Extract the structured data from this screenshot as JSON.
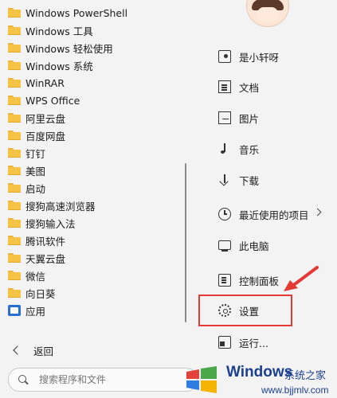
{
  "apps": [
    {
      "label": "Windows PowerShell",
      "icon": "folder-icon"
    },
    {
      "label": "Windows 工具",
      "icon": "folder-icon"
    },
    {
      "label": "Windows 轻松使用",
      "icon": "folder-icon"
    },
    {
      "label": "Windows 系统",
      "icon": "folder-icon"
    },
    {
      "label": "WinRAR",
      "icon": "folder-icon"
    },
    {
      "label": "WPS Office",
      "icon": "folder-icon"
    },
    {
      "label": "阿里云盘",
      "icon": "folder-icon"
    },
    {
      "label": "百度网盘",
      "icon": "folder-icon"
    },
    {
      "label": "钉钉",
      "icon": "folder-icon"
    },
    {
      "label": "美图",
      "icon": "folder-icon"
    },
    {
      "label": "启动",
      "icon": "folder-icon"
    },
    {
      "label": "搜狗高速浏览器",
      "icon": "folder-icon"
    },
    {
      "label": "搜狗输入法",
      "icon": "folder-icon"
    },
    {
      "label": "腾讯软件",
      "icon": "folder-icon"
    },
    {
      "label": "天翼云盘",
      "icon": "folder-icon"
    },
    {
      "label": "微信",
      "icon": "folder-icon"
    },
    {
      "label": "向日葵",
      "icon": "folder-icon"
    },
    {
      "label": "应用",
      "icon": "app-icon"
    }
  ],
  "places": [
    {
      "label": "是小轩呀",
      "icon": "user-folder-icon"
    },
    {
      "label": "文档",
      "icon": "document-icon"
    },
    {
      "label": "图片",
      "icon": "picture-icon"
    },
    {
      "label": "音乐",
      "icon": "music-icon"
    },
    {
      "label": "下载",
      "icon": "download-icon"
    },
    {
      "label": "最近使用的项目",
      "icon": "clock-icon"
    },
    {
      "label": "此电脑",
      "icon": "computer-icon"
    },
    {
      "label": "控制面板",
      "icon": "control-panel-icon"
    },
    {
      "label": "设置",
      "icon": "gear-icon"
    },
    {
      "label": "运行...",
      "icon": "run-icon"
    }
  ],
  "back_label": "返回",
  "search": {
    "placeholder": "搜索程序和文件"
  },
  "watermark": {
    "title": "Windows",
    "subtitle": "系统之家",
    "url": "www.bjjmlv.com"
  },
  "colors": {
    "highlight": "#e53935",
    "folder": "#f6c445",
    "brand": "#1b3f8f"
  }
}
